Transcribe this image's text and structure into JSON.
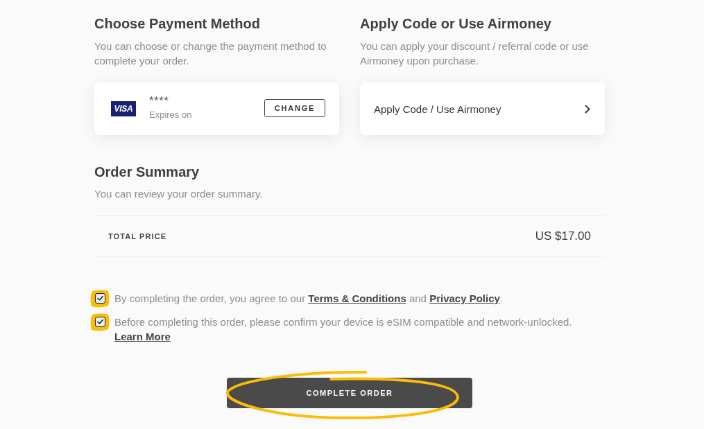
{
  "payment": {
    "title": "Choose Payment Method",
    "description": "You can choose or change the payment method to complete your order.",
    "card": {
      "brand": "VISA",
      "number": "****",
      "expiry_label": "Expires on"
    },
    "change_button": "CHANGE"
  },
  "promo": {
    "title": "Apply Code or Use Airmoney",
    "description": "You can apply your discount / referral code or use Airmoney upon purchase.",
    "action": "Apply Code / Use Airmoney"
  },
  "summary": {
    "title": "Order Summary",
    "description": "You can review your order summary.",
    "rows": [
      {
        "label": "TOTAL PRICE",
        "value": "US $17.00"
      }
    ]
  },
  "agreements": [
    {
      "checked": true,
      "highlighted": true,
      "segments": [
        {
          "kind": "text",
          "text": "By completing the order, you agree to our "
        },
        {
          "kind": "link",
          "text": "Terms & Conditions"
        },
        {
          "kind": "text",
          "text": " and "
        },
        {
          "kind": "link",
          "text": "Privacy Policy"
        },
        {
          "kind": "text",
          "text": "."
        }
      ]
    },
    {
      "checked": true,
      "highlighted": true,
      "segments": [
        {
          "kind": "text",
          "text": "Before completing this order, please confirm your device is eSIM compatible and network-unlocked. "
        },
        {
          "kind": "link",
          "text": "Learn More"
        }
      ]
    }
  ],
  "submit": {
    "label": "COMPLETE ORDER",
    "highlighted": true
  }
}
